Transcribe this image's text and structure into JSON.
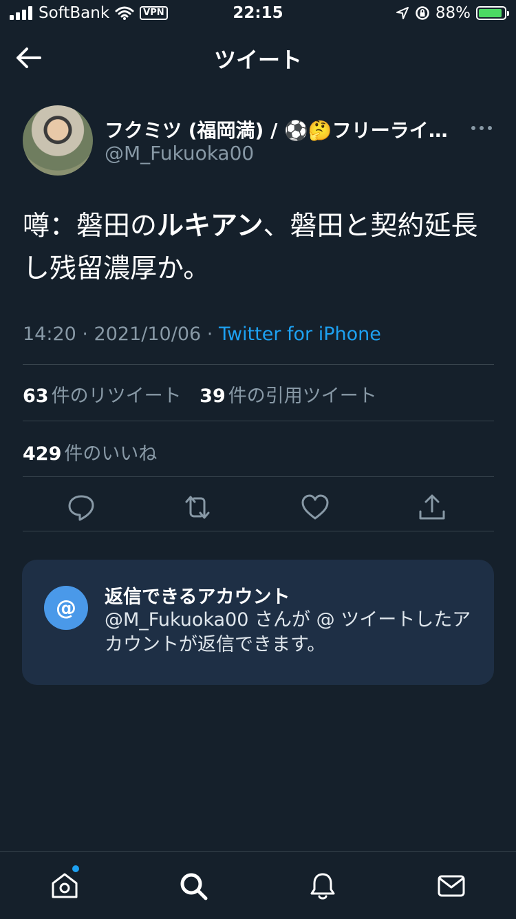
{
  "status_bar": {
    "carrier": "SoftBank",
    "vpn": "VPN",
    "time": "22:15",
    "battery": "88%",
    "battery_level": 0.88
  },
  "header": {
    "title": "ツイート",
    "back_icon": "arrow-left-icon"
  },
  "author": {
    "display_name": "フクミツ (福岡満) / ⚽🤔フリーライ…",
    "handle": "@M_Fukuoka00",
    "more_icon": "more-horizontal-icon"
  },
  "tweet": {
    "text_part1": "噂：磐田の",
    "text_bold": "ルキアン",
    "text_part2": "、磐田と契約延長し残留濃厚か。",
    "timestamp": "14:20 · 2021/10/06 · ",
    "source": "Twitter for iPhone"
  },
  "stats": {
    "retweets_count": "63",
    "retweets_label": "件のリツイート",
    "quotes_count": "39",
    "quotes_label": "件の引用ツイート",
    "likes_count": "429",
    "likes_label": "件のいいね"
  },
  "actions": {
    "reply_icon": "reply-icon",
    "retweet_icon": "retweet-icon",
    "like_icon": "heart-icon",
    "share_icon": "share-icon"
  },
  "reply_card": {
    "icon_text": "@",
    "title": "返信できるアカウント",
    "body": "@M_Fukuoka00 さんが @ ツイートしたアカウントが返信できます。"
  },
  "bottom_nav": {
    "items": [
      "home-icon",
      "search-icon",
      "notifications-icon",
      "messages-icon"
    ],
    "accent_color": "#1da1f2"
  }
}
